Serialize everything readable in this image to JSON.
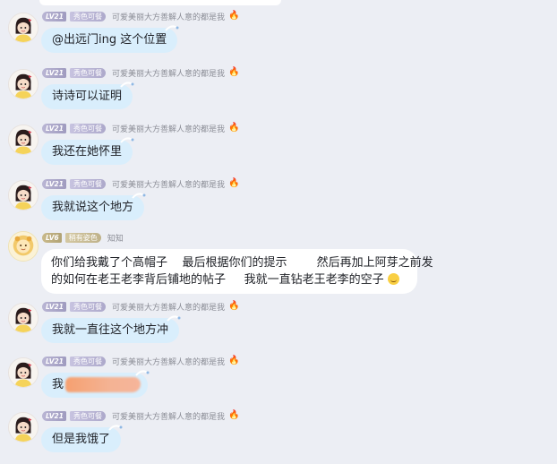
{
  "colors": {
    "background": "#eceef4",
    "bubble_blue": "#d9eefc",
    "bubble_white": "#ffffff",
    "badge_purple": "#a9a5c8",
    "badge_gold": "#bfb28a",
    "nick_gray": "#8b8d96",
    "flame": "#f26a2c"
  },
  "messages": [
    {
      "level": "LV21",
      "title": "秀色可餐",
      "nick": "可爱美丽大方善解人意的都是我",
      "icon": "flame-icon",
      "text": "@出远门ing 这个位置"
    },
    {
      "level": "LV21",
      "title": "秀色可餐",
      "nick": "可爱美丽大方善解人意的都是我",
      "icon": "flame-icon",
      "text": "诗诗可以证明"
    },
    {
      "level": "LV21",
      "title": "秀色可餐",
      "nick": "可爱美丽大方善解人意的都是我",
      "icon": "flame-icon",
      "text": "我还在她怀里"
    },
    {
      "level": "LV21",
      "title": "秀色可餐",
      "nick": "可爱美丽大方善解人意的都是我",
      "icon": "flame-icon",
      "text": "我就说这个地方"
    },
    {
      "level": "LV6",
      "title": "稍有姿色",
      "nick": "知知",
      "text_line1": "你们给我戴了个高帽子    最后根据你们的提示        然后再加上阿芽之前发",
      "text_line2": "的如何在老王老李背后铺地的帖子     我就一直钻老王老李的空子",
      "icon": "grin-emoji-icon"
    },
    {
      "level": "LV21",
      "title": "秀色可餐",
      "nick": "可爱美丽大方善解人意的都是我",
      "icon": "flame-icon",
      "text": "我就一直往这个地方冲"
    },
    {
      "level": "LV21",
      "title": "秀色可餐",
      "nick": "可爱美丽大方善解人意的都是我",
      "icon": "flame-icon",
      "text": "我",
      "redacted": true
    },
    {
      "level": "LV21",
      "title": "秀色可餐",
      "nick": "可爱美丽大方善解人意的都是我",
      "icon": "flame-icon",
      "text": "但是我饿了"
    }
  ]
}
